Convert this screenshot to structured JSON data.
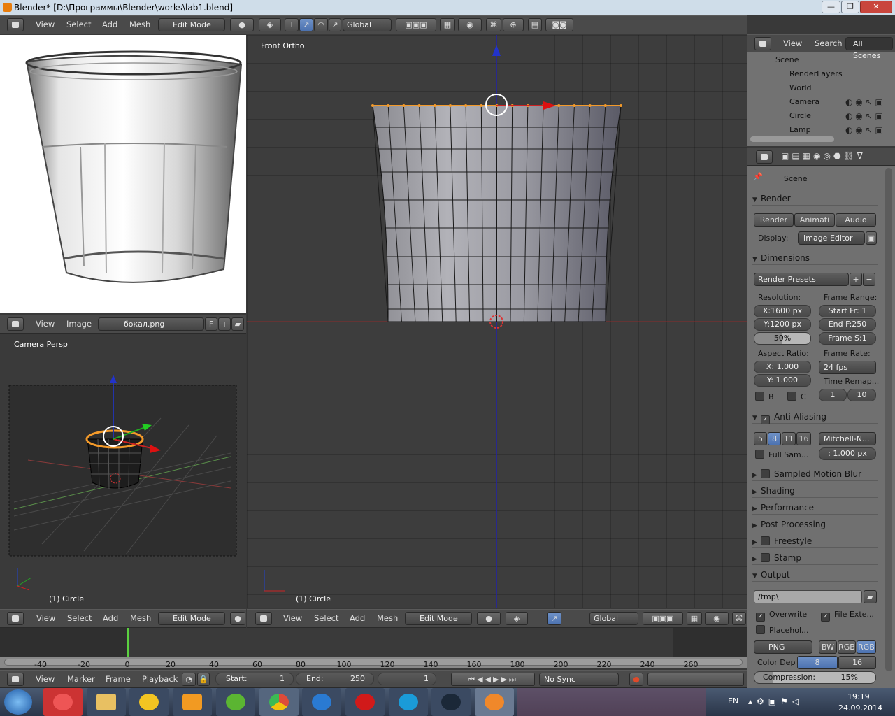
{
  "window": {
    "title": "Blender* [D:\\Программы\\Blender\\works\\lab1.blend]",
    "controls": [
      "—",
      "❐",
      "✕"
    ]
  },
  "top_header": {
    "menus": [
      "View",
      "Select",
      "Add",
      "Mesh"
    ],
    "mode": "Edit Mode",
    "orientation": "Global"
  },
  "outliner": {
    "menus": [
      "View",
      "Search"
    ],
    "scenes": "All Scenes",
    "items": [
      "Scene",
      "RenderLayers",
      "World",
      "Camera",
      "Circle",
      "Lamp"
    ]
  },
  "image_editor": {
    "menus": [
      "View",
      "Image"
    ],
    "image_name": "бокал.png",
    "flag": "F"
  },
  "camera_view": {
    "label": "Camera Persp",
    "object": "(1) Circle"
  },
  "main_view": {
    "label": "Front Ortho",
    "object": "(1) Circle"
  },
  "bottom_header_left": {
    "menus": [
      "View",
      "Select",
      "Add",
      "Mesh"
    ],
    "mode": "Edit Mode"
  },
  "bottom_header_main": {
    "menus": [
      "View",
      "Select",
      "Add",
      "Mesh"
    ],
    "mode": "Edit Mode",
    "orientation": "Global"
  },
  "properties": {
    "context": "Scene",
    "render": {
      "title": "Render",
      "buttons": [
        "Render",
        "Animati",
        "Audio"
      ],
      "display_label": "Display:",
      "display_value": "Image Editor"
    },
    "dimensions": {
      "title": "Dimensions",
      "presets": "Render Presets",
      "resolution_label": "Resolution:",
      "res_x": "X:1600 px",
      "res_y": "Y:1200 px",
      "percent": "50%",
      "frame_range_label": "Frame Range:",
      "start": "Start Fr:  1",
      "end": "End F:250",
      "step": "Frame S:1",
      "aspect_label": "Aspect Ratio:",
      "aspect_x": "X:   1.000",
      "aspect_y": "Y:   1.000",
      "frame_rate_label": "Frame Rate:",
      "fps": "24 fps",
      "time_remap_label": "Time Remap...",
      "remap_old": "1",
      "remap_new": "10",
      "b": "B",
      "c": "C"
    },
    "aa": {
      "title": "Anti-Aliasing",
      "samples": [
        "5",
        "8",
        "11",
        "16"
      ],
      "filter": "Mitchell-N...",
      "full_sample": "Full Sam...",
      "size": ": 1.000 px"
    },
    "collapsed": [
      "Sampled Motion Blur",
      "Shading",
      "Performance",
      "Post Processing",
      "Freestyle",
      "Stamp"
    ],
    "output": {
      "title": "Output",
      "path": "/tmp\\",
      "overwrite": "Overwrite",
      "file_ext": "File Exte...",
      "placeholders": "Placehol...",
      "format": "PNG",
      "color_modes": [
        "BW",
        "RGB",
        "RGB"
      ],
      "color_depth_label": "Color Dep",
      "depths": [
        "8",
        "16"
      ],
      "compression": "Compression:",
      "compression_value": "15%"
    }
  },
  "timeline": {
    "ticks": [
      "-40",
      "-20",
      "0",
      "20",
      "40",
      "60",
      "80",
      "100",
      "120",
      "140",
      "160",
      "180",
      "200",
      "220",
      "240",
      "260"
    ],
    "current_frame_marker": 0,
    "menus": [
      "View",
      "Marker",
      "Frame",
      "Playback"
    ],
    "start": "Start:",
    "start_val": "1",
    "end": "End:",
    "end_val": "250",
    "current": "1",
    "sync": "No Sync"
  },
  "taskbar": {
    "lang": "EN",
    "time": "19:19",
    "date": "24.09.2014"
  }
}
